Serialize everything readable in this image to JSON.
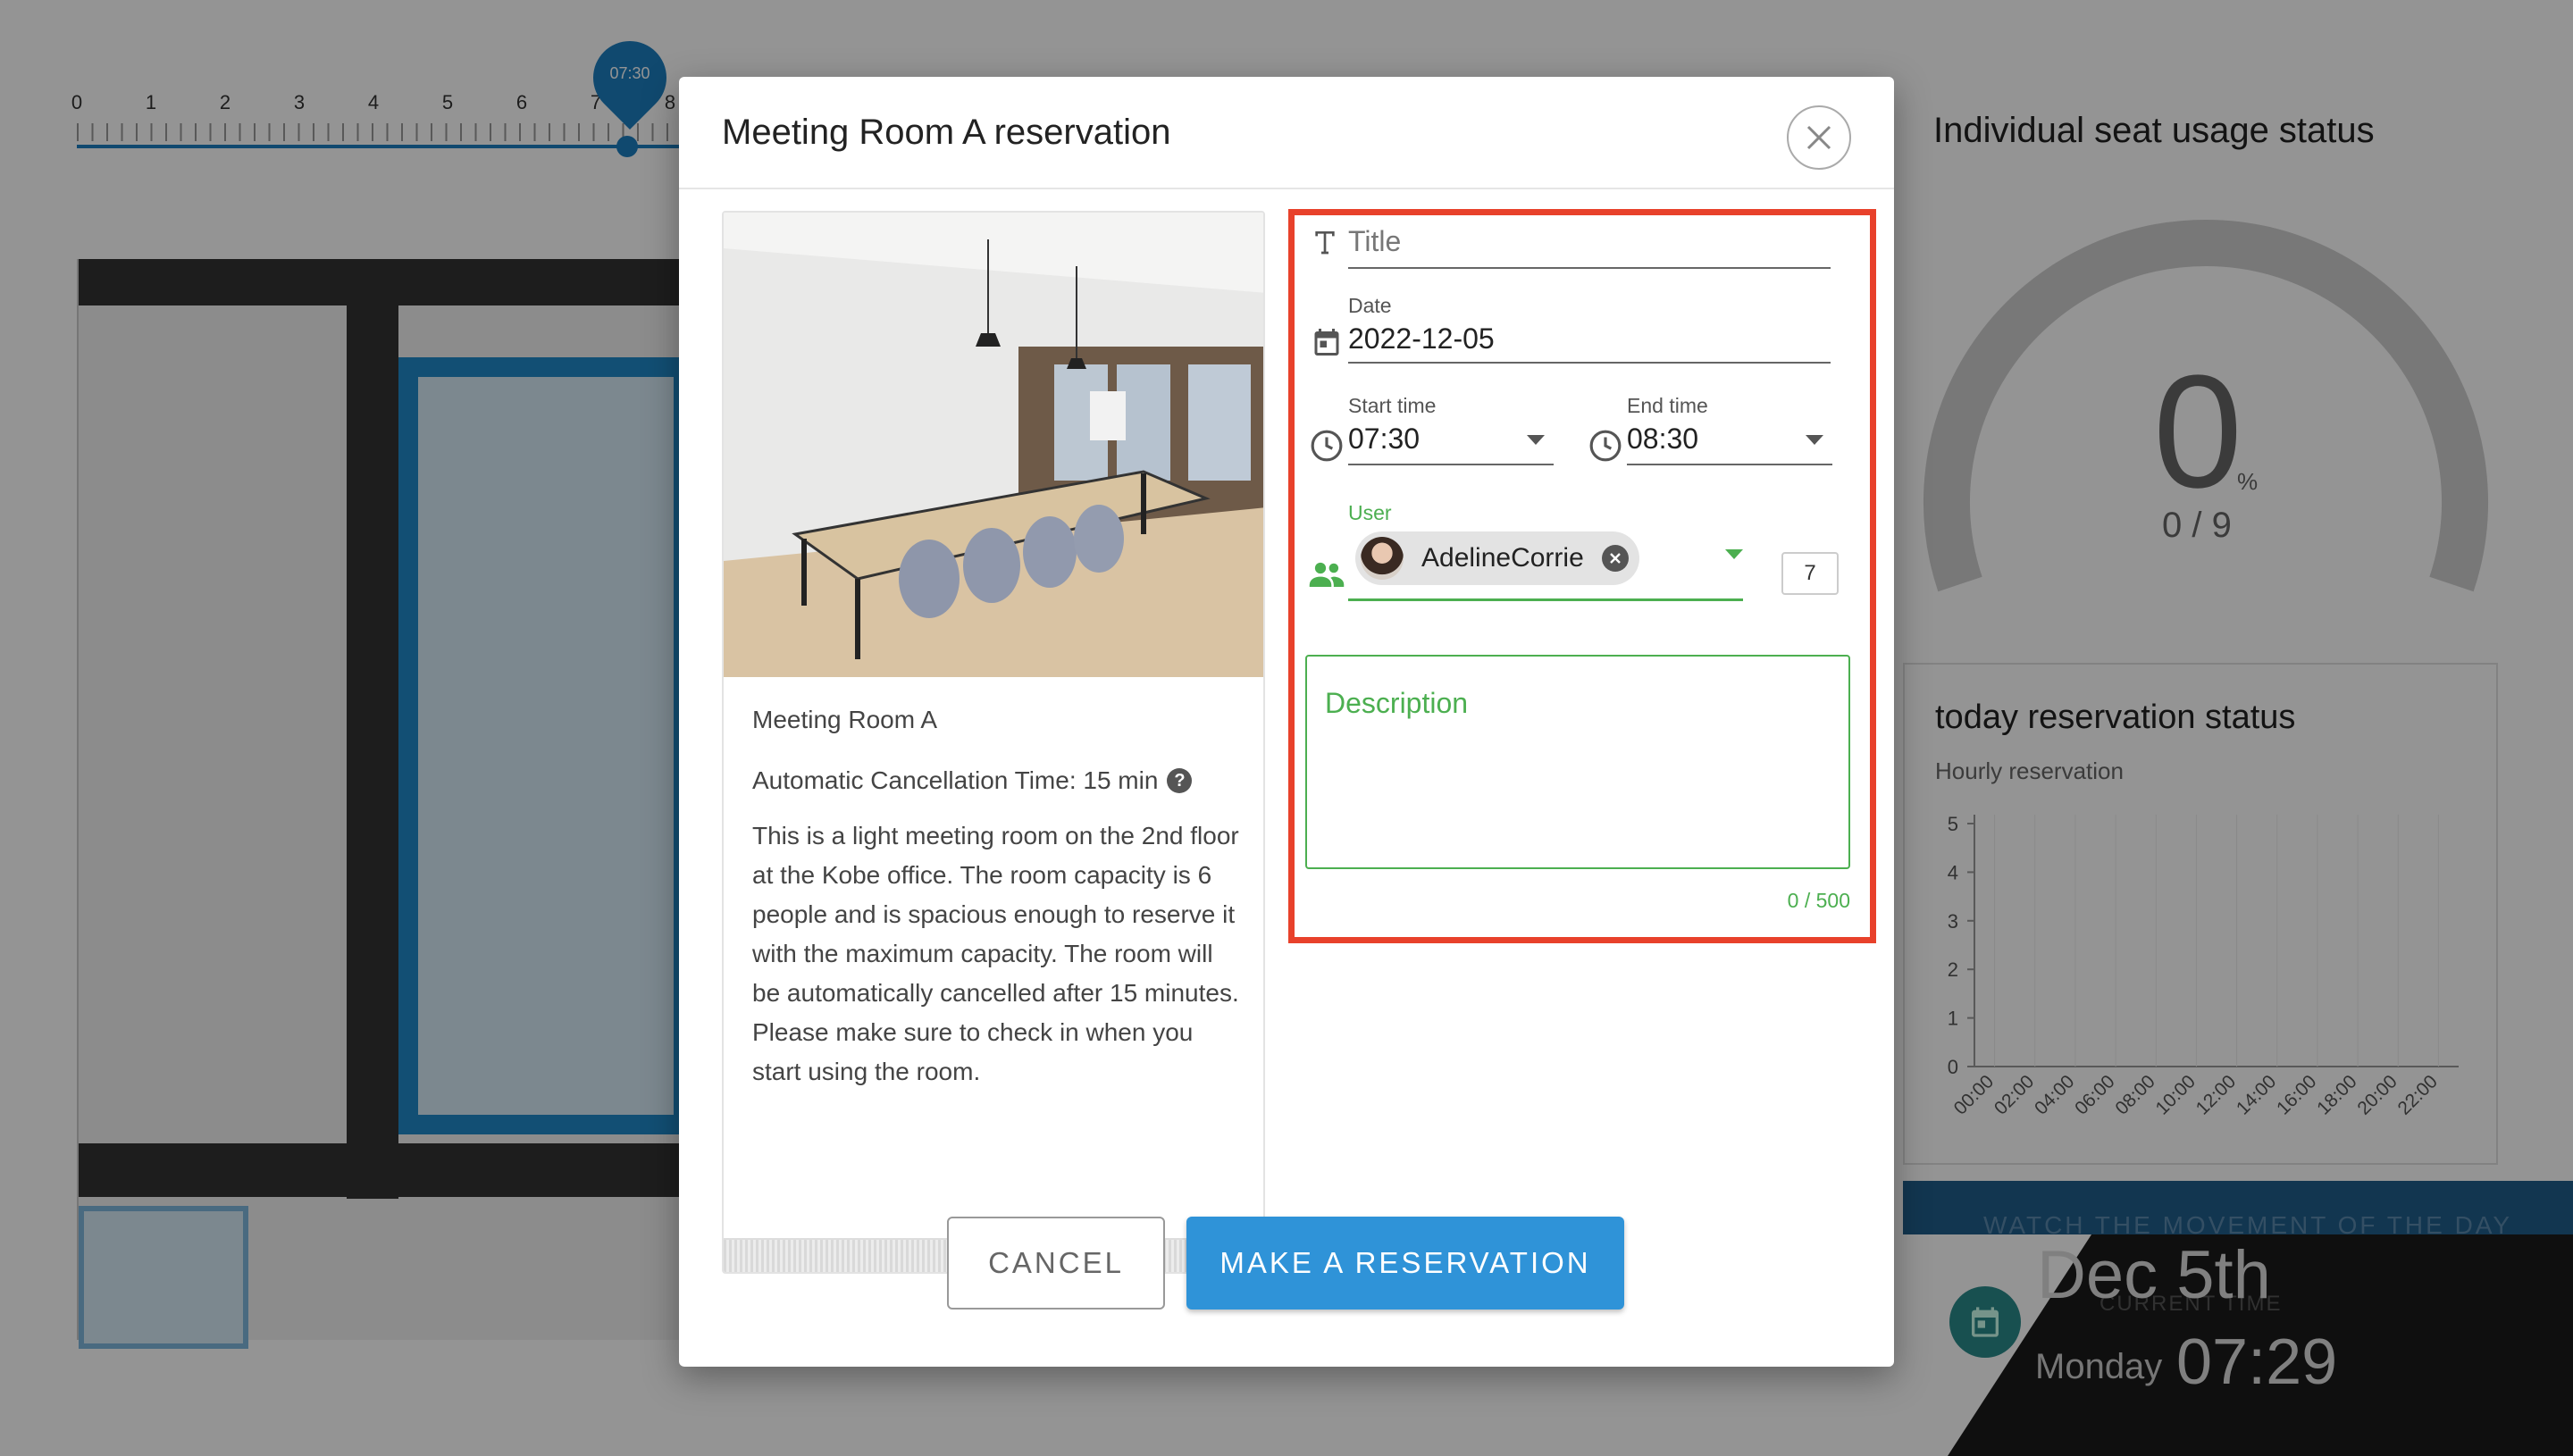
{
  "timeline": {
    "hours": [
      "0",
      "1",
      "2",
      "3",
      "4",
      "5",
      "6",
      "7",
      "8"
    ],
    "current_time": "07:30"
  },
  "right_panel": {
    "seat_usage_title": "Individual seat usage status",
    "gauge": {
      "value": "0",
      "unit": "%",
      "count": "0 / 9"
    },
    "today_status": {
      "title": "today reservation status",
      "subtitle": "Hourly reservation",
      "y_ticks": [
        "0",
        "1",
        "2",
        "3",
        "4",
        "5"
      ],
      "x_ticks": [
        "00:00",
        "02:00",
        "04:00",
        "06:00",
        "08:00",
        "10:00",
        "12:00",
        "14:00",
        "16:00",
        "18:00",
        "20:00",
        "22:00"
      ]
    },
    "watch_banner": "WATCH THE MOVEMENT OF THE DAY",
    "current_time_label": "CURRENT TIME",
    "date": "Dec 5th",
    "weekday": "Monday",
    "time": "07:29"
  },
  "dialog": {
    "title": "Meeting Room A reservation",
    "room": {
      "name": "Meeting Room A",
      "auto_cancel": "Automatic Cancellation Time: 15 min",
      "description": "This is a light meeting room on the 2nd floor at the Kobe office. The room capacity is 6 people and is spacious enough to reserve it with the maximum capacity. The room will be automatically cancelled after 15 minutes. Please make sure to check in when you start using the room."
    },
    "form": {
      "title_placeholder": "Title",
      "date_label": "Date",
      "date_value": "2022-12-05",
      "start_label": "Start time",
      "start_value": "07:30",
      "end_label": "End time",
      "end_value": "08:30",
      "user_label": "User",
      "user_name": "AdelineCorrie",
      "user_count": "7",
      "description_placeholder": "Description",
      "description_counter": "0 / 500"
    },
    "buttons": {
      "cancel": "CANCEL",
      "submit": "MAKE A RESERVATION"
    }
  },
  "colors": {
    "accent_blue": "#2f93d8",
    "highlight_red": "#e8412b",
    "success_green": "#4caf50"
  }
}
